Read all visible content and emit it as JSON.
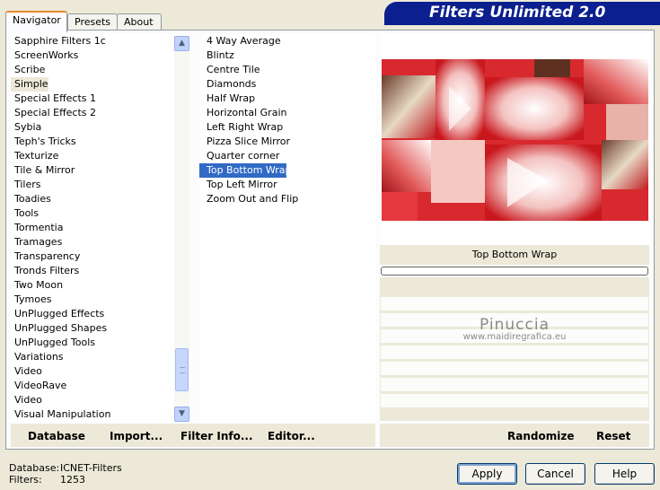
{
  "tabs": [
    "Navigator",
    "Presets",
    "About"
  ],
  "banner_title": "Filters Unlimited 2.0",
  "categories": [
    "Sapphire Filters 1c",
    "ScreenWorks",
    "Scribe",
    "Simple",
    "Special Effects 1",
    "Special Effects 2",
    "Sybia",
    "Teph's Tricks",
    "Texturize",
    "Tile & Mirror",
    "Tilers",
    "Toadies",
    "Tools",
    "Tormentia",
    "Tramages",
    "Transparency",
    "Tronds Filters",
    "Two Moon",
    "Tymoes",
    "UnPlugged Effects",
    "UnPlugged Shapes",
    "UnPlugged Tools",
    "Variations",
    "Video",
    "VideoRave",
    "Video",
    "Visual Manipulation"
  ],
  "selected_category": "Simple",
  "filters": [
    "4 Way Average",
    "Blintz",
    "Centre Tile",
    "Diamonds",
    "Half Wrap",
    "Horizontal Grain",
    "Left Right Wrap",
    "Pizza Slice Mirror",
    "Quarter corner",
    "Top Bottom Wrap",
    "Top Left Mirror",
    "Zoom Out and Flip"
  ],
  "selected_filter": "Top Bottom Wrap",
  "preview_filter_label": "Top Bottom Wrap",
  "watermark": {
    "name": "Pinuccia",
    "site": "www.maidiregrafica.eu"
  },
  "toolbar": {
    "database": "Database",
    "import": "Import...",
    "filter_info": "Filter Info...",
    "editor": "Editor...",
    "randomize": "Randomize",
    "reset": "Reset"
  },
  "status": {
    "database_label": "Database:",
    "database_value": "ICNET-Filters",
    "filters_label": "Filters:",
    "filters_value": "1253"
  },
  "buttons": {
    "apply": "Apply",
    "cancel": "Cancel",
    "help": "Help"
  },
  "colors": {
    "banner": "#0b1f8e",
    "selection": "#316ac5",
    "preview_red": "#d8292f"
  }
}
